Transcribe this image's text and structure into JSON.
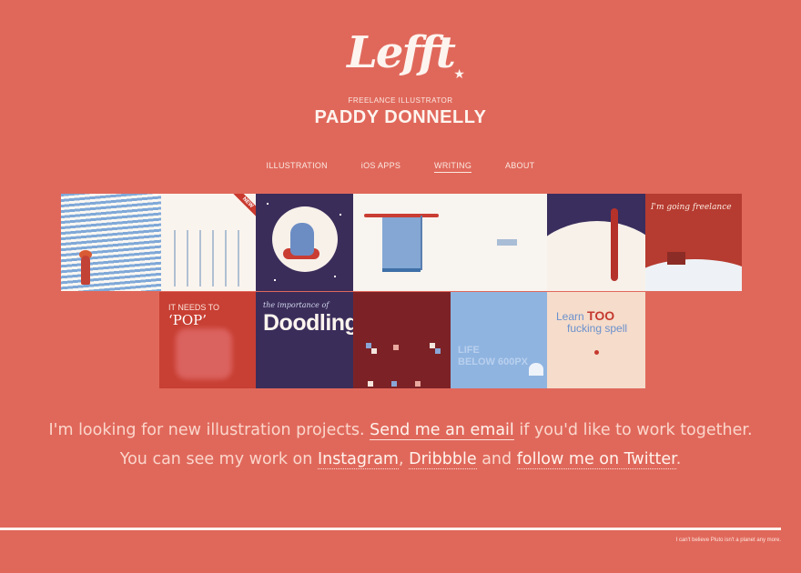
{
  "brand": {
    "logo_text": "Lefft",
    "tagline": "FREELANCE ILLUSTRATOR",
    "name": "PADDY DONNELLY"
  },
  "nav": [
    {
      "label": "ILLUSTRATION",
      "active": false
    },
    {
      "label": "iOS APPS",
      "active": false
    },
    {
      "label": "WRITING",
      "active": true
    },
    {
      "label": "ABOUT",
      "active": false
    }
  ],
  "tiles": {
    "sea": {
      "ribbon": "NEW"
    },
    "freelance": {
      "text": "I'm going freelance"
    },
    "pop": {
      "text": "IT NEEDS TO",
      "highlight": "‘POP’"
    },
    "doodling": {
      "subtitle": "the importance of",
      "title": "Doodling"
    },
    "below600": {
      "line1": "LIFE",
      "line2": "BELOW 600PX"
    },
    "spell": {
      "line1": "Learn",
      "highlight": "TOO",
      "line2": "fucking spell"
    }
  },
  "message": {
    "line1_pre": "I'm looking for new illustration projects.",
    "email_link": "Send me an email",
    "line1_post": "if you'd like to work together.",
    "line2_pre": "You can see my work on",
    "instagram_link": "Instagram",
    "comma": ",",
    "dribbble_link": "Dribbble",
    "and": "and",
    "twitter_link": "follow me on Twitter",
    "period": "."
  },
  "footer": {
    "note": "I can't believe Pluto isn't a planet any more."
  },
  "colors": {
    "background": "#e0685b",
    "navy": "#3b2d5a",
    "red": "#c83f33",
    "blue": "#84a7d4"
  }
}
